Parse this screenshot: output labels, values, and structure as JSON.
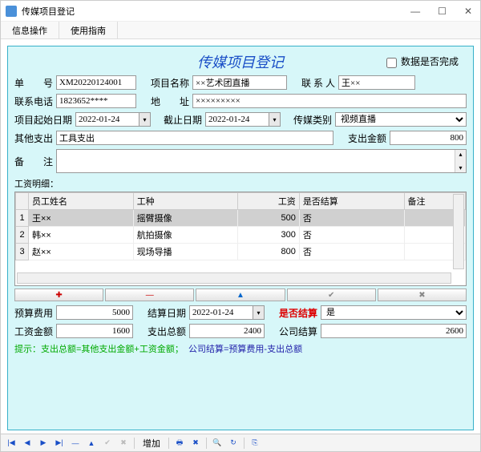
{
  "window": {
    "title": "传媒项目登记"
  },
  "menu": {
    "info": "信息操作",
    "guide": "使用指南"
  },
  "header": {
    "title": "传媒项目登记",
    "complete_label": "数据是否完成"
  },
  "labels": {
    "order_no": "单  号",
    "project_name": "项目名称",
    "contact": "联 系 人",
    "phone": "联系电话",
    "address": "地  址",
    "start_date": "项目起始日期",
    "end_date": "截止日期",
    "media_type": "传媒类别",
    "other_expense": "其他支出",
    "amount": "支出金额",
    "remark": "备  注",
    "detail": "工资明细：",
    "budget": "预算费用",
    "settle_date": "结算日期",
    "is_settle": "是否结算",
    "wage_amount": "工资金额",
    "expense_total": "支出总额",
    "company_settle": "公司结算",
    "add_button": "增加"
  },
  "values": {
    "order_no": "XM20220124001",
    "project_name": "××艺术团直播",
    "contact": "王××",
    "phone": "1823652****",
    "address": "×××××××××",
    "start_date": "2022-01-24",
    "end_date": "2022-01-24",
    "media_type": "视频直播",
    "other_expense": "工具支出",
    "amount": "800",
    "budget": "5000",
    "settle_date": "2022-01-24",
    "is_settle": "是",
    "wage_amount": "1600",
    "expense_total": "2400",
    "company_settle": "2600"
  },
  "grid": {
    "cols": {
      "name": "员工姓名",
      "type": "工种",
      "wage": "工资",
      "settled": "是否结算",
      "remark": "备注"
    },
    "rows": [
      {
        "n": "1",
        "name": "王××",
        "type": "摇臂摄像",
        "wage": "500",
        "settled": "否",
        "remark": ""
      },
      {
        "n": "2",
        "name": "韩××",
        "type": "航拍摄像",
        "wage": "300",
        "settled": "否",
        "remark": ""
      },
      {
        "n": "3",
        "name": "赵××",
        "type": "现场导播",
        "wage": "800",
        "settled": "否",
        "remark": ""
      }
    ]
  },
  "tip": {
    "prefix": "提示：",
    "part1": "支出总额=其他支出金额+工资金额；",
    "part2": "公司结算=预算费用-支出总额"
  },
  "icons": {
    "plus": "✚",
    "minus": "—",
    "up": "▲",
    "down": "▼",
    "check": "✔",
    "x": "✖",
    "first": "|◀",
    "prev": "◀",
    "next": "▶",
    "last": "▶|",
    "edit": "✎",
    "print": "🖶",
    "del": "✖",
    "find": "🔍",
    "refresh": "↻",
    "export": "⎘"
  }
}
